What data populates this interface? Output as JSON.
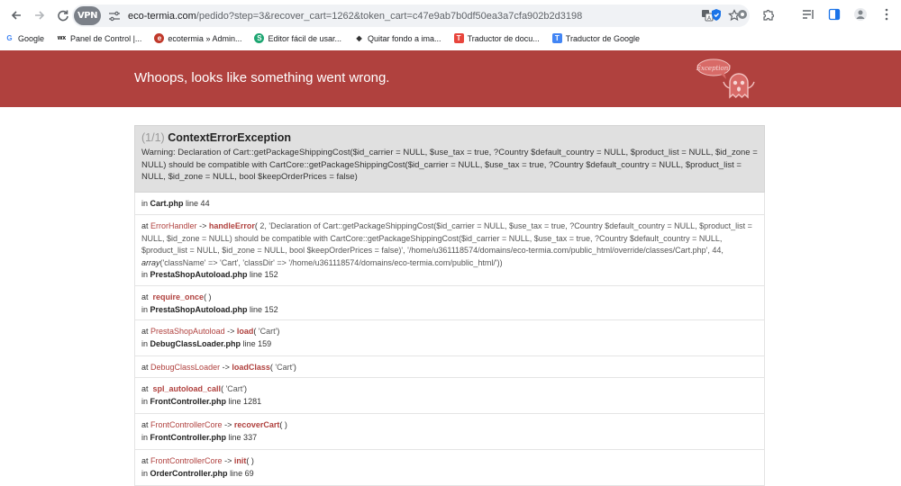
{
  "browser": {
    "url_host": "eco-termia.com",
    "url_path": "/pedido?step=3&recover_cart=1262&token_cart=c47e9ab7b0df50ea3a7cfa902b2d3198",
    "vpn_label": "VPN"
  },
  "bookmarks": [
    {
      "label": "Google",
      "icon": "G",
      "color": "#4285f4"
    },
    {
      "label": "Panel de Control |...",
      "icon": "wx",
      "color": "#000"
    },
    {
      "label": "ecotermia » Admin...",
      "icon": "e",
      "color": "#c0392b"
    },
    {
      "label": "Editor fácil de usar...",
      "icon": "S",
      "color": "#1ea672"
    },
    {
      "label": "Quitar fondo a ima...",
      "icon": "◆",
      "color": "#333"
    },
    {
      "label": "Traductor de docu...",
      "icon": "T",
      "color": "#e8453c"
    },
    {
      "label": "Traductor de Google",
      "icon": "T",
      "color": "#4285f4"
    }
  ],
  "header": {
    "title": "Whoops, looks like something went wrong.",
    "ghost_label": "Exception!"
  },
  "exception": {
    "count": "(1/1)",
    "name": "ContextErrorException",
    "message": "Warning: Declaration of Cart::getPackageShippingCost($id_carrier = NULL, $use_tax = true, ?Country $default_country = NULL, $product_list = NULL, $id_zone = NULL) should be compatible with CartCore::getPackageShippingCost($id_carrier = NULL, $use_tax = true, ?Country $default_country = NULL, $product_list = NULL, $id_zone = NULL, bool $keepOrderPrices = false)"
  },
  "trace": {
    "t0": {
      "file": "Cart.php",
      "line": "line 44"
    },
    "t1": {
      "class": "ErrorHandler",
      "fn": "handleError",
      "args": "2, 'Declaration of Cart::getPackageShippingCost($id_carrier = NULL, $use_tax = true, ?Country $default_country = NULL, $product_list = NULL, $id_zone = NULL) should be compatible with CartCore::getPackageShippingCost($id_carrier = NULL, $use_tax = true, ?Country $default_country = NULL, $product_list = NULL, $id_zone = NULL, bool $keepOrderPrices = false)', '/home/u361118574/domains/eco-termia.com/public_html/override/classes/Cart.php', 44,",
      "array_kw": "array",
      "array_args": "('className' => 'Cart', 'classDir' => '/home/u361118574/domains/eco-termia.com/public_html/'))",
      "file": "PrestaShopAutoload.php",
      "line": "line 152"
    },
    "t2": {
      "fn": "require_once",
      "file": "PrestaShopAutoload.php",
      "line": "line 152"
    },
    "t3": {
      "class": "PrestaShopAutoload",
      "fn": "load",
      "args": "'Cart'",
      "file": "DebugClassLoader.php",
      "line": "line 159"
    },
    "t4": {
      "class": "DebugClassLoader",
      "fn": "loadClass",
      "args": "'Cart'"
    },
    "t5": {
      "fn": "spl_autoload_call",
      "args": "'Cart'",
      "file": "FrontController.php",
      "line": "line 1281"
    },
    "t6": {
      "class": "FrontControllerCore",
      "fn": "recoverCart",
      "file": "FrontController.php",
      "line": "line 337"
    },
    "t7": {
      "class": "FrontControllerCore",
      "fn": "init",
      "file": "OrderController.php",
      "line": "line 69"
    }
  },
  "labels": {
    "at": "at",
    "in": "in",
    "arrow": "->"
  }
}
